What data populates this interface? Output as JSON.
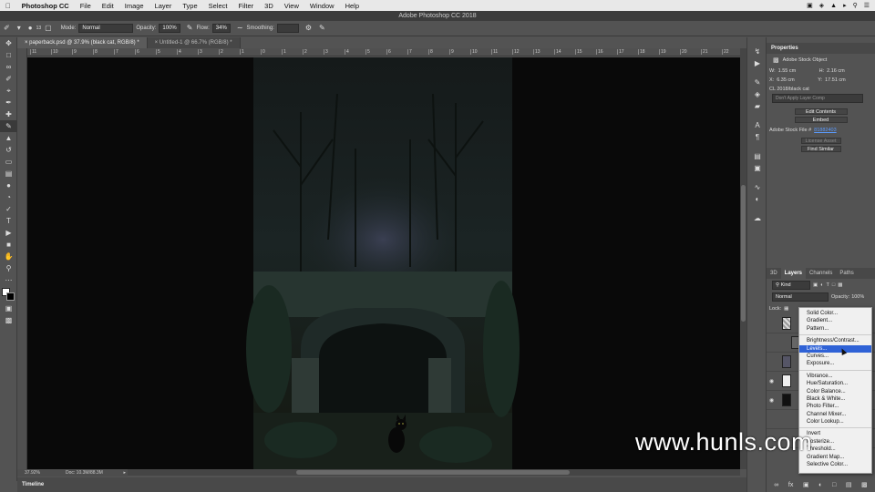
{
  "menubar": {
    "app_name": "Photoshop CC",
    "items": [
      "File",
      "Edit",
      "Image",
      "Layer",
      "Type",
      "Select",
      "Filter",
      "3D",
      "View",
      "Window",
      "Help"
    ]
  },
  "window": {
    "title": "Adobe Photoshop CC 2018"
  },
  "options": {
    "brush_size": "13",
    "mode_label": "Mode:",
    "mode_value": "Normal",
    "opacity_label": "Opacity:",
    "opacity_value": "100%",
    "flow_label": "Flow:",
    "flow_value": "34%",
    "smoothing_label": "Smoothing:"
  },
  "tabs": [
    {
      "label": "paperback.psd @ 37.9% (black cat, RGB/8) *",
      "active": true
    },
    {
      "label": "Untitled-1 @ 66.7% (RGB/8) *",
      "active": false
    }
  ],
  "ruler_numbers": [
    "11",
    "10",
    "9",
    "8",
    "7",
    "6",
    "5",
    "4",
    "3",
    "2",
    "1",
    "0",
    "1",
    "2",
    "3",
    "4",
    "5",
    "6",
    "7",
    "8",
    "9",
    "10",
    "11",
    "12",
    "13",
    "14",
    "15",
    "16",
    "17",
    "18",
    "19",
    "20",
    "21",
    "22"
  ],
  "status": {
    "zoom": "37.92%",
    "doc": "Doc: 10.3M/88.3M"
  },
  "timeline_label": "Timeline",
  "properties": {
    "title": "Properties",
    "object_type": "Adobe Stock Object",
    "w_label": "W:",
    "w_value": "1.55 cm",
    "h_label": "H:",
    "h_value": "2.16 cm",
    "x_label": "X:",
    "x_value": "6.35 cm",
    "y_label": "Y:",
    "y_value": "17.51 cm",
    "source": "CL 2018/black cat",
    "layer_comp": "Don't Apply Layer Comp",
    "edit_contents": "Edit Contents",
    "embed": "Embed",
    "stock_file_label": "Adobe Stock File #",
    "stock_file_number": "81882403",
    "license_asset": "License Asset",
    "find_similar": "Find Similar"
  },
  "layers": {
    "tabs": [
      "3D",
      "Layers",
      "Channels",
      "Paths"
    ],
    "kind_label": "Kind",
    "blend_mode": "Normal",
    "opacity_label": "Opacity:",
    "opacity_value": "100%",
    "lock_label": "Lock:"
  },
  "adjustment_menu": {
    "groups": [
      [
        "Solid Color...",
        "Gradient...",
        "Pattern..."
      ],
      [
        "Brightness/Contrast...",
        "Levels...",
        "Curves...",
        "Exposure..."
      ],
      [
        "Vibrance...",
        "Hue/Saturation...",
        "Color Balance...",
        "Black & White...",
        "Photo Filter...",
        "Channel Mixer...",
        "Color Lookup..."
      ],
      [
        "Invert",
        "Posterize...",
        "Threshold...",
        "Gradient Map...",
        "Selective Color..."
      ]
    ],
    "highlighted": "Levels..."
  },
  "watermark": "www.hunls.com",
  "colors": {
    "highlight": "#2f62d6",
    "canvas": "#090909",
    "ui": "#535353"
  }
}
